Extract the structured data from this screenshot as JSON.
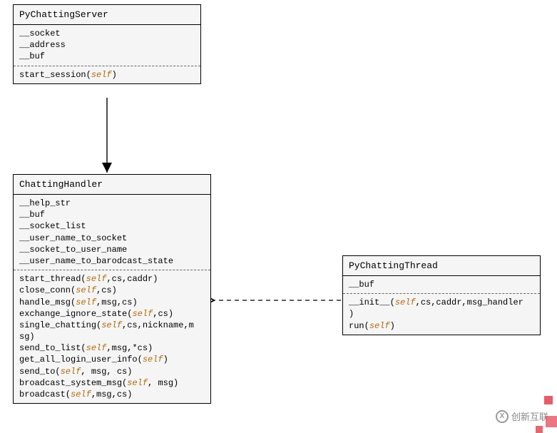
{
  "class_server": {
    "name": "PyChattingServer",
    "attrs": [
      "__socket",
      "__address",
      "__buf"
    ],
    "methods": [
      {
        "raw": "start_session(self)",
        "pre": "start_session(",
        "self": "self",
        "post": ")"
      }
    ]
  },
  "class_handler": {
    "name": "ChattingHandler",
    "attrs": [
      "__help_str",
      "__buf",
      "__socket_list",
      "__user_name_to_socket",
      "__socket_to_user_name",
      "__user_name_to_barodcast_state"
    ],
    "methods": [
      {
        "pre": "start_thread(",
        "self": "self",
        "post": ",cs,caddr)"
      },
      {
        "pre": "close_conn(",
        "self": "self",
        "post": ",cs)"
      },
      {
        "pre": "handle_msg(",
        "self": "self",
        "post": ",msg,cs)"
      },
      {
        "pre": "exchange_ignore_state(",
        "self": "self",
        "post": ",cs)"
      },
      {
        "pre": "single_chatting(",
        "self": "self",
        "post": ",cs,nickname,m"
      },
      {
        "pre": "sg)",
        "self": "",
        "post": ""
      },
      {
        "pre": "send_to_list(",
        "self": "self",
        "post": ",msg,*cs)"
      },
      {
        "pre": "get_all_login_user_info(",
        "self": "self",
        "post": ")"
      },
      {
        "pre": "send_to(",
        "self": "self",
        "post": ", msg, cs)"
      },
      {
        "pre": "broadcast_system_msg(",
        "self": "self",
        "post": ", msg)"
      },
      {
        "pre": "broadcast(",
        "self": "self",
        "post": ",msg,cs)"
      }
    ]
  },
  "class_thread": {
    "name": "PyChattingThread",
    "attrs": [
      "__buf"
    ],
    "methods": [
      {
        "pre": "__init__(",
        "self": "self",
        "post": ",cs,caddr,msg_handler"
      },
      {
        "pre": ")",
        "self": "",
        "post": ""
      },
      {
        "pre": "run(",
        "self": "self",
        "post": ")"
      }
    ]
  },
  "watermark": {
    "label": "创新互联",
    "logo": "X"
  }
}
